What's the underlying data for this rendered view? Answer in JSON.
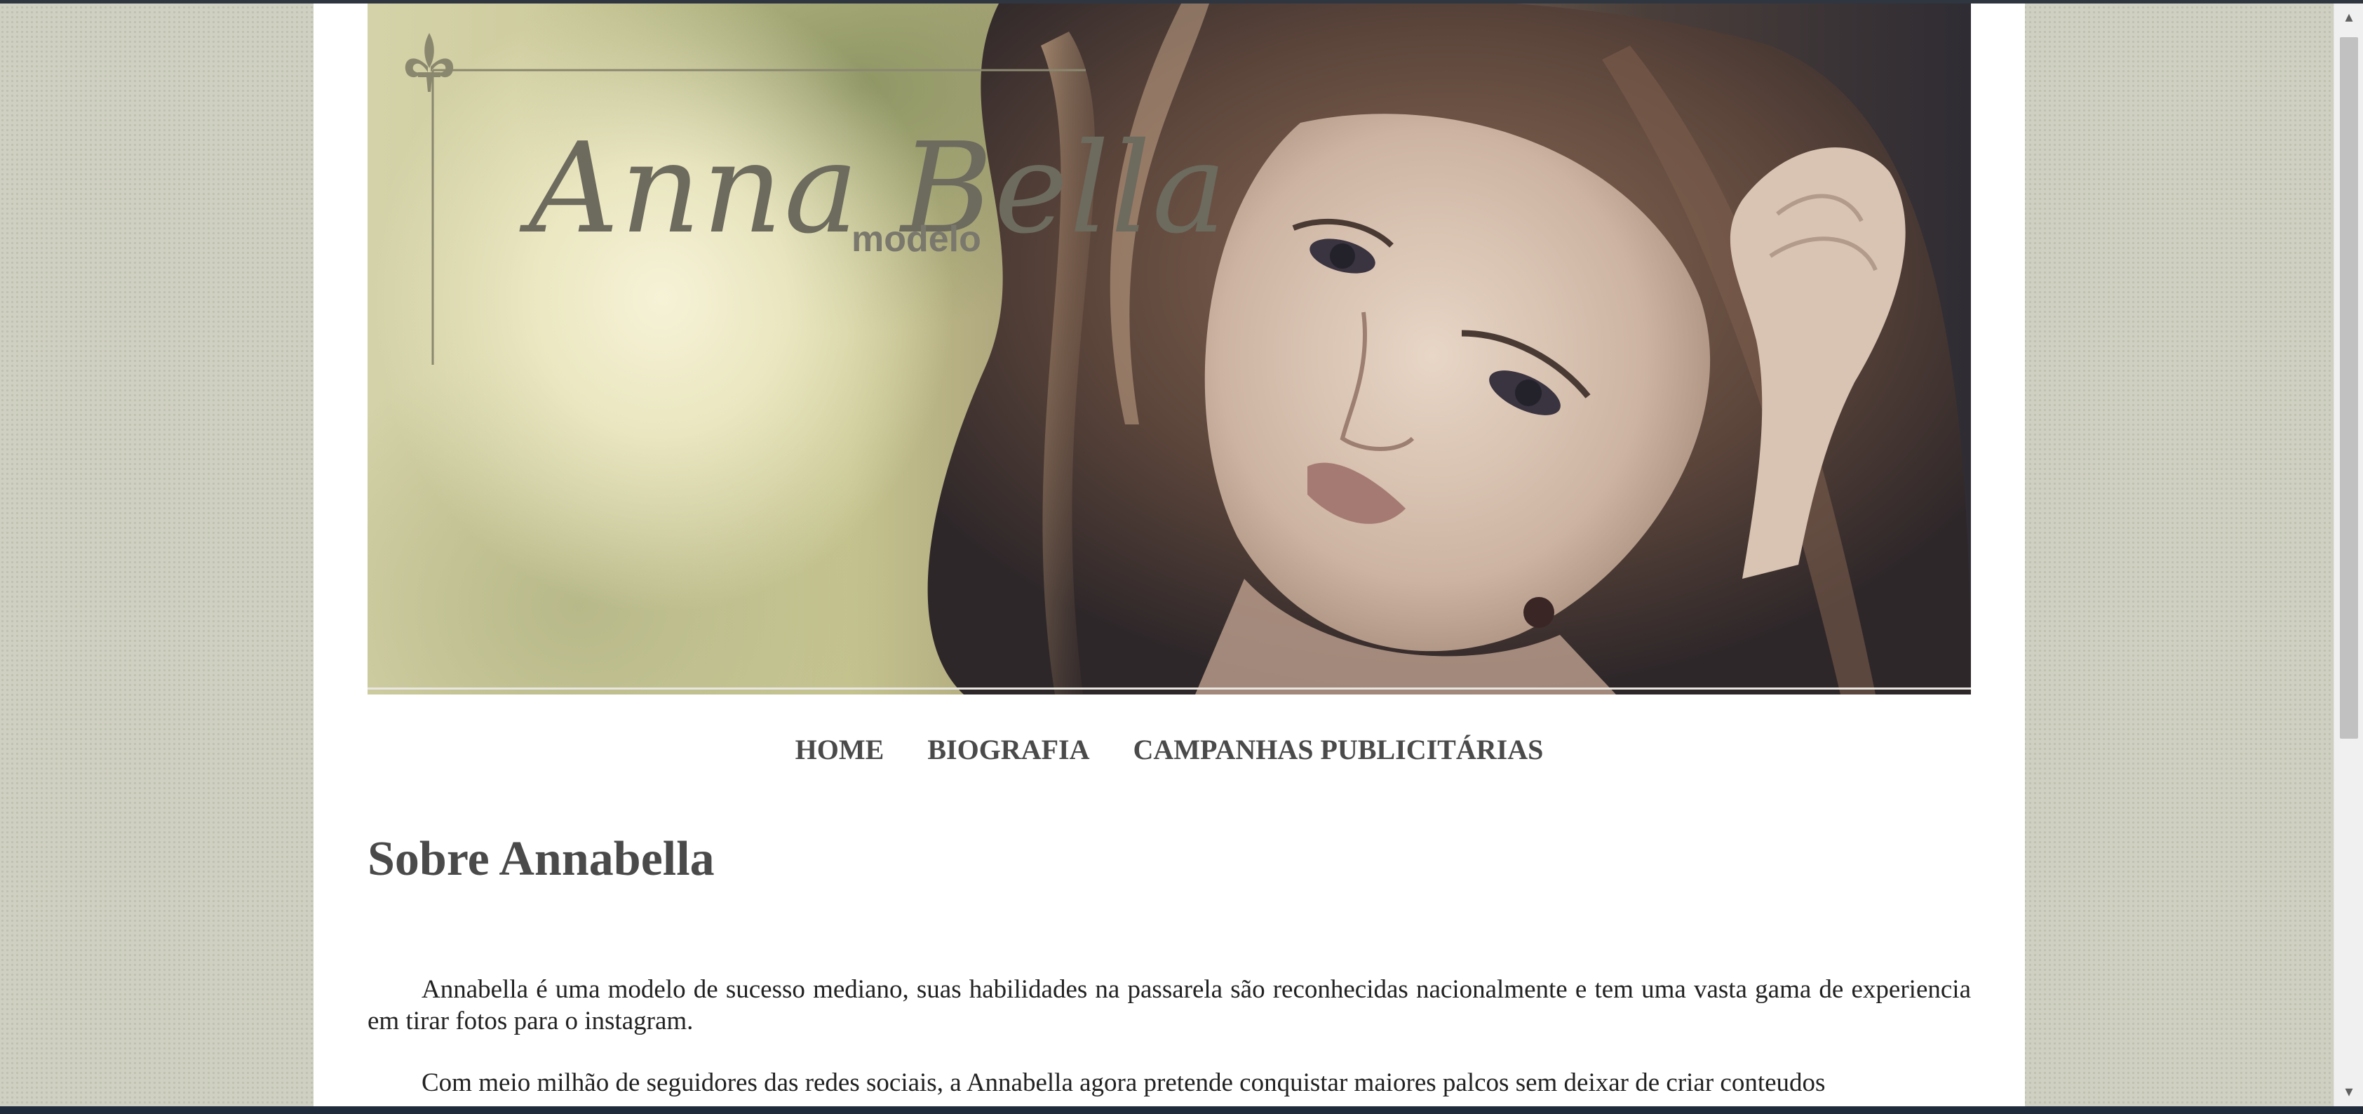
{
  "banner": {
    "brand_name": "Anna Bella",
    "brand_subtitle": "modelo",
    "ornament_icon": "fleur-de-lis-icon",
    "photo_description_icon": "model-portrait"
  },
  "nav": {
    "items": [
      {
        "label": "HOME"
      },
      {
        "label": "BIOGRAFIA"
      },
      {
        "label": "CAMPANHAS PUBLICITÁRIAS"
      }
    ]
  },
  "main": {
    "title": "Sobre Annabella",
    "paragraphs": [
      "Annabella é uma modelo de sucesso mediano, suas habilidades na passarela são reconhecidas nacionalmente e tem uma vasta gama de experiencia em tirar fotos para o instagram.",
      "Com meio milhão de seguidores das redes sociais, a Annabella agora pretende conquistar maiores palcos sem deixar de criar conteudos"
    ]
  },
  "colors": {
    "page_background": "#cfd0c1",
    "content_background": "#ffffff",
    "heading": "#4a4a4a",
    "logo": "#6d6a5e"
  }
}
